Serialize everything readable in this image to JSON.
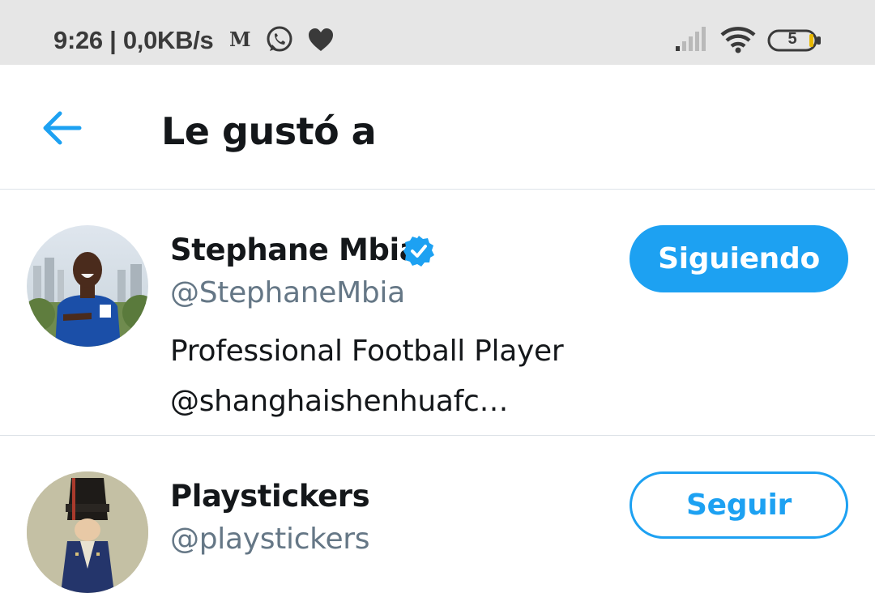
{
  "status_bar": {
    "time_and_speed": "9:26 | 0,0KB/s",
    "mail_icon": "gmail-icon",
    "whatsapp_icon": "whatsapp-icon",
    "heart_icon": "heart-icon",
    "signal_icon": "signal-icon",
    "wifi_icon": "wifi-icon",
    "battery_level": "5"
  },
  "header": {
    "back_icon": "arrow-left-icon",
    "title": "Le gustó a"
  },
  "users": [
    {
      "name": "Stephane Mbia",
      "verified": true,
      "handle": "@StephaneMbia",
      "bio_lines": [
        "Professional Football Player",
        "@shanghaishenhuafc…"
      ],
      "button_label": "Siguiendo"
    },
    {
      "name": "Playstickers",
      "verified": false,
      "handle": "@playstickers",
      "bio_lines": [],
      "button_label": "Seguir"
    }
  ],
  "colors": {
    "accent": "#1da1f2",
    "text_primary": "#14171a",
    "text_secondary": "#657786",
    "status_bar_bg": "#e6e6e6",
    "divider": "#dde3e8"
  }
}
